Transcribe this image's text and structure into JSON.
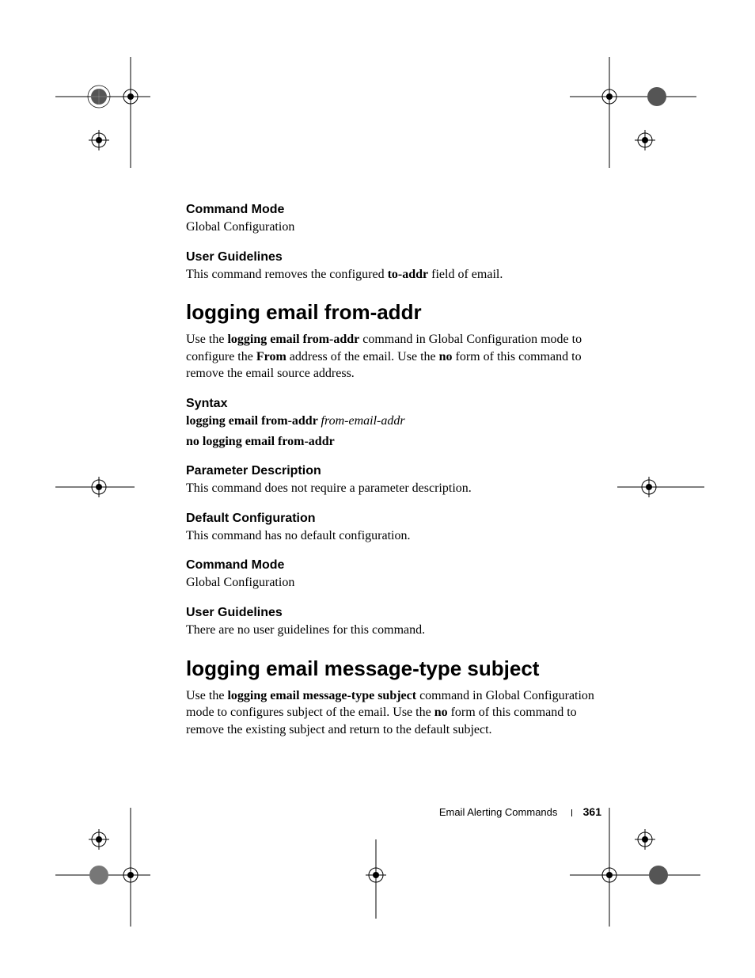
{
  "sections": {
    "cmdMode1": {
      "heading": "Command Mode",
      "body": "Global Configuration"
    },
    "userGuide1": {
      "heading": "User Guidelines",
      "body_pre": "This command removes the configured ",
      "body_bold": "to-addr",
      "body_post": " field of email."
    },
    "major1": {
      "title": "logging email from-addr",
      "p_pre": "Use the ",
      "p_b1": "logging email from-addr",
      "p_mid1": " command in Global Configuration mode to configure the ",
      "p_b2": "From",
      "p_mid2": " address of the email. Use the ",
      "p_b3": "no",
      "p_post": " form of this command to remove the email source address."
    },
    "syntax": {
      "heading": "Syntax",
      "line1_b": "logging email from-addr ",
      "line1_i": "from-email-addr",
      "line2": "no logging email from-addr"
    },
    "paramDesc": {
      "heading": "Parameter Description",
      "body": "This command does not require a parameter description."
    },
    "defaultCfg": {
      "heading": "Default Configuration",
      "body": "This command has no default configuration."
    },
    "cmdMode2": {
      "heading": "Command Mode",
      "body": "Global Configuration"
    },
    "userGuide2": {
      "heading": "User Guidelines",
      "body": "There are no user guidelines for this command."
    },
    "major2": {
      "title": "logging email message-type subject",
      "p_pre": "Use the ",
      "p_b1": "logging email message-type subject",
      "p_mid1": " command in Global Configuration mode to configures subject of the email. Use the ",
      "p_b2": "no",
      "p_post": " form of this command to remove the existing subject and return to the default subject."
    }
  },
  "footer": {
    "section": "Email Alerting Commands",
    "page": "361"
  }
}
